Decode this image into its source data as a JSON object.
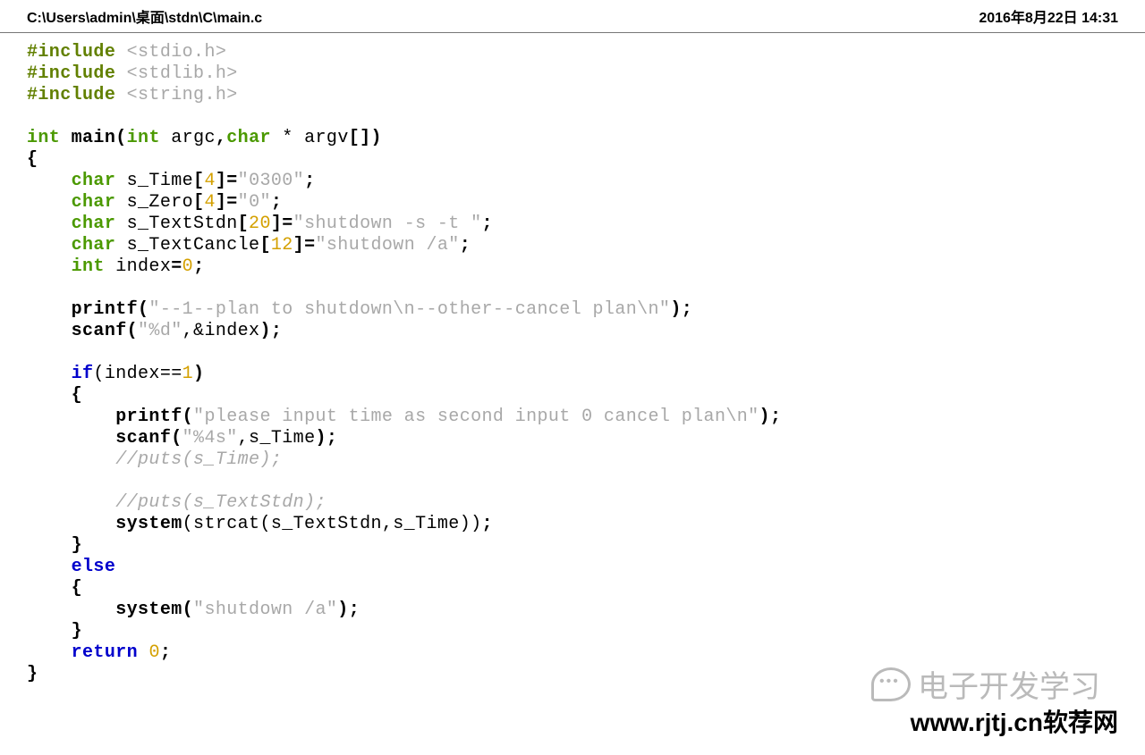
{
  "header": {
    "path": "C:\\Users\\admin\\桌面\\stdn\\C\\main.c",
    "timestamp": "2016年8月22日 14:31"
  },
  "code": {
    "inc1": "#include ",
    "hdr1": "<stdio.h>",
    "inc2": "#include ",
    "hdr2": "<stdlib.h>",
    "inc3": "#include ",
    "hdr3": "<string.h>",
    "int": "int",
    "main": " main",
    "lp": "(",
    "argc": " argc",
    "comma": ",",
    "char": "char",
    "star": " * ",
    "argv": "argv",
    "brk": "[])",
    "ob": "{",
    "cb": "}",
    "indent1": "    ",
    "indent2": "        ",
    "s_time_decl_a": " s_Time",
    "n4": "4",
    "eq": "=",
    "v0300": "\"0300\"",
    "semi": ";",
    "s_zero_decl": " s_Zero",
    "v0": "\"0\"",
    "s_textstdn_decl": " s_TextStdn",
    "n20": "20",
    "vshut": "\"shutdown -s -t \"",
    "s_textcancle_decl": " s_TextCancle",
    "n12": "12",
    "vshuta": "\"shutdown /a\"",
    "index_decl": " index",
    "zero": "0",
    "printf": "printf",
    "msg1": "\"--1--plan to shutdown\\n--other--cancel plan\\n\"",
    "rp": ")",
    "scanf": "scanf",
    "fmtd": "\"%d\"",
    "amp_index": ",&index",
    "if": "if",
    "cond": "(index==",
    "one": "1",
    "msg2": "\"please input time as second input 0 cancel plan\\n\"",
    "fmt4s": "\"%4s\"",
    "stime_arg": ",s_Time",
    "cmt1": "//puts(s_Time);",
    "cmt2": "//puts(s_TextStdn);",
    "system": "system",
    "strcat_call": "(strcat(s_TextStdn,s_Time))",
    "else": "else",
    "shuta_call_a": "(",
    "shuta_str": "\"shutdown /a\"",
    "return": "return",
    "sp": " ",
    "lbrk": "[",
    "rbrk": "]"
  },
  "watermark1": "电子开发学习",
  "watermark2": "www.rjtj.cn软荐网"
}
